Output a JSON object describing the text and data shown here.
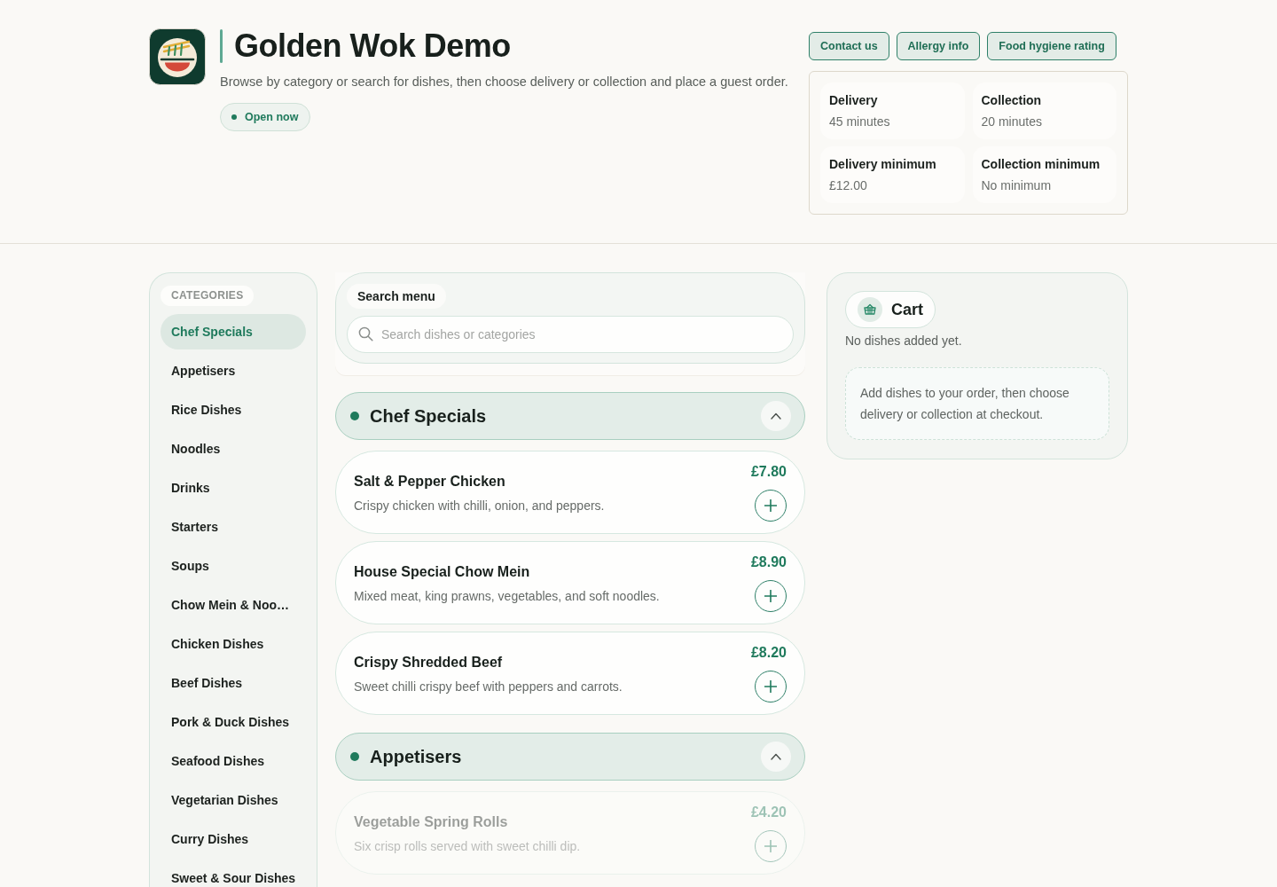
{
  "header": {
    "title": "Golden Wok Demo",
    "subtitle": "Browse by category or search for dishes, then choose delivery or collection and place a guest order.",
    "status": "Open now",
    "links": [
      "Contact us",
      "Allergy info",
      "Food hygiene rating"
    ],
    "info_cards": [
      {
        "label": "Delivery",
        "value": "45 minutes"
      },
      {
        "label": "Collection",
        "value": "20 minutes"
      },
      {
        "label": "Delivery minimum",
        "value": "£12.00"
      },
      {
        "label": "Collection minimum",
        "value": "No minimum"
      }
    ]
  },
  "sidebar": {
    "heading": "CATEGORIES",
    "items": [
      {
        "label": "Chef Specials",
        "selected": true
      },
      {
        "label": "Appetisers",
        "selected": false
      },
      {
        "label": "Rice Dishes",
        "selected": false
      },
      {
        "label": "Noodles",
        "selected": false
      },
      {
        "label": "Drinks",
        "selected": false
      },
      {
        "label": "Starters",
        "selected": false
      },
      {
        "label": "Soups",
        "selected": false
      },
      {
        "label": "Chow Mein & Noo…",
        "selected": false
      },
      {
        "label": "Chicken Dishes",
        "selected": false
      },
      {
        "label": "Beef Dishes",
        "selected": false
      },
      {
        "label": "Pork & Duck Dishes",
        "selected": false
      },
      {
        "label": "Seafood Dishes",
        "selected": false
      },
      {
        "label": "Vegetarian Dishes",
        "selected": false
      },
      {
        "label": "Curry Dishes",
        "selected": false
      },
      {
        "label": "Sweet & Sour Dishes",
        "selected": false
      }
    ]
  },
  "search": {
    "label": "Search menu",
    "placeholder": "Search dishes or categories"
  },
  "menu_sections": [
    {
      "title": "Chef Specials",
      "expanded": true,
      "dishes": [
        {
          "name": "Salt & Pepper Chicken",
          "description": "Crispy chicken with chilli, onion, and peppers.",
          "price": "£7.80",
          "disabled": false
        },
        {
          "name": "House Special Chow Mein",
          "description": "Mixed meat, king prawns, vegetables, and soft noodles.",
          "price": "£8.90",
          "disabled": false
        },
        {
          "name": "Crispy Shredded Beef",
          "description": "Sweet chilli crispy beef with peppers and carrots.",
          "price": "£8.20",
          "disabled": false
        }
      ]
    },
    {
      "title": "Appetisers",
      "expanded": true,
      "dishes": [
        {
          "name": "Vegetable Spring Rolls",
          "description": "Six crisp rolls served with sweet chilli dip.",
          "price": "£4.20",
          "disabled": true
        }
      ]
    }
  ],
  "cart": {
    "title": "Cart",
    "status": "No dishes added yet.",
    "hint": "Add dishes to your order, then choose delivery or collection at checkout."
  }
}
